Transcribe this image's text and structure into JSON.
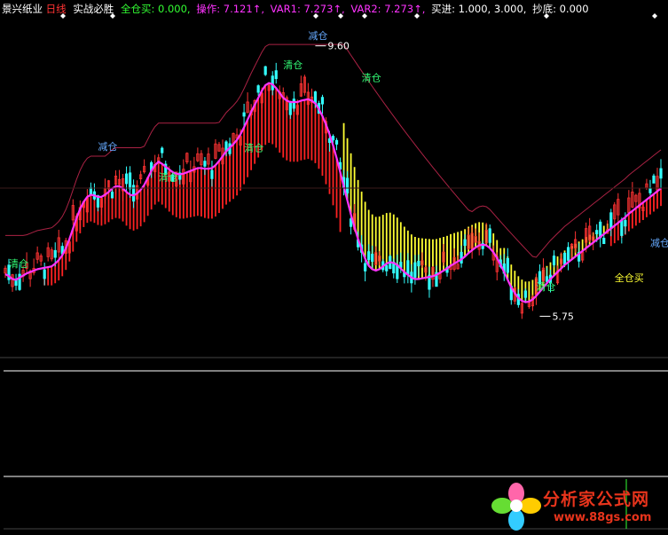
{
  "header": {
    "stock_name": "景兴纸业",
    "period": "日线",
    "indicator_name": "实战必胜",
    "items": [
      {
        "label": "全仓买: 0.000,",
        "color": "#33ff33"
      },
      {
        "label": "操作: 7.121↑,",
        "color": "#ff33ff"
      },
      {
        "label": "VAR1: 7.273↑,",
        "color": "#ff33ff"
      },
      {
        "label": "VAR2: 7.273↑,",
        "color": "#ff33ff"
      },
      {
        "label": "买进: 1.000, 3.000,",
        "color": "#ffffff"
      },
      {
        "label": "抄底: 0.000",
        "color": "#ffffff"
      }
    ]
  },
  "colors": {
    "line": "#ff33ff",
    "rise_candle": "#ff3333",
    "fall_candle": "#33ffff",
    "bull_bar": "#ff2222",
    "bear_bar": "#ffff33",
    "stop_line": "#aa2244",
    "text_reduce": "#66aaff",
    "text_clear": "#33ff77",
    "text_buy": "#ffff33"
  },
  "chart_data": {
    "type": "line",
    "title": "",
    "xlabel": "",
    "ylabel": "",
    "ylim": [
      5.2,
      10.0
    ],
    "x": [
      1,
      2,
      3,
      4,
      5,
      6,
      7,
      8,
      9,
      10,
      11,
      12,
      13,
      14,
      15,
      16,
      17,
      18,
      19,
      20,
      21,
      22,
      23,
      24,
      25,
      26,
      27,
      28,
      29,
      30,
      31,
      32,
      33,
      34,
      35,
      36,
      37,
      38,
      39,
      40,
      41,
      42,
      43,
      44,
      45,
      46,
      47,
      48,
      49,
      50,
      51,
      52,
      53,
      54,
      55,
      56,
      57,
      58,
      59,
      60,
      61,
      62,
      63,
      64,
      65,
      66,
      67,
      68,
      69,
      70,
      71,
      72,
      73,
      74,
      75,
      76,
      77,
      78,
      79,
      80,
      81,
      82,
      83,
      84,
      85,
      86,
      87,
      88,
      89,
      90,
      91,
      92,
      93,
      94,
      95,
      96,
      97,
      98,
      99,
      100,
      101,
      102,
      103,
      104,
      105,
      106,
      107,
      108,
      109,
      110,
      111,
      112,
      113,
      114,
      115,
      116,
      117,
      118,
      119,
      120,
      121,
      122,
      123,
      124,
      125,
      126,
      127,
      128,
      129,
      130,
      131,
      132,
      133,
      134,
      135,
      136,
      137,
      138,
      139,
      140,
      141,
      142,
      143,
      144,
      145,
      146,
      147,
      148,
      149,
      150,
      151,
      152,
      153,
      154,
      155,
      156,
      157,
      158,
      159,
      160,
      161,
      162,
      163,
      164,
      165,
      166,
      167,
      168,
      169,
      170,
      171,
      172,
      173,
      174,
      175,
      176,
      177,
      178,
      179,
      180,
      181,
      182,
      183,
      184,
      185
    ],
    "series": [
      {
        "name": "操作",
        "values": [
          6.35,
          6.32,
          6.28,
          6.27,
          6.3,
          6.33,
          6.36,
          6.38,
          6.4,
          6.42,
          6.43,
          6.44,
          6.45,
          6.46,
          6.5,
          6.55,
          6.62,
          6.72,
          6.85,
          7.0,
          7.15,
          7.28,
          7.38,
          7.45,
          7.48,
          7.47,
          7.45,
          7.45,
          7.48,
          7.52,
          7.57,
          7.6,
          7.6,
          7.57,
          7.52,
          7.48,
          7.47,
          7.5,
          7.55,
          7.62,
          7.72,
          7.82,
          7.9,
          7.95,
          7.92,
          7.88,
          7.84,
          7.8,
          7.78,
          7.77,
          7.78,
          7.8,
          7.82,
          7.84,
          7.86,
          7.86,
          7.85,
          7.85,
          7.86,
          7.9,
          7.96,
          8.03,
          8.1,
          8.15,
          8.2,
          8.26,
          8.34,
          8.44,
          8.55,
          8.66,
          8.76,
          8.86,
          8.96,
          9.04,
          9.07,
          9.05,
          9.0,
          8.93,
          8.86,
          8.82,
          8.8,
          8.8,
          8.8,
          8.82,
          8.83,
          8.84,
          8.82,
          8.78,
          8.7,
          8.6,
          8.48,
          8.34,
          8.18,
          8.0,
          7.8,
          7.6,
          7.4,
          7.2,
          7.02,
          6.85,
          6.7,
          6.57,
          6.47,
          6.42,
          6.4,
          6.42,
          6.46,
          6.5,
          6.52,
          6.51,
          6.48,
          6.43,
          6.38,
          6.34,
          6.3,
          6.28,
          6.28,
          6.29,
          6.3,
          6.31,
          6.32,
          6.34,
          6.37,
          6.4,
          6.43,
          6.47,
          6.5,
          6.53,
          6.56,
          6.6,
          6.65,
          6.69,
          6.73,
          6.76,
          6.77,
          6.76,
          6.72,
          6.66,
          6.58,
          6.48,
          6.38,
          6.27,
          6.16,
          6.08,
          6.01,
          5.97,
          5.95,
          5.96,
          5.99,
          6.04,
          6.1,
          6.16,
          6.22,
          6.28,
          6.33,
          6.38,
          6.43,
          6.48,
          6.52,
          6.56,
          6.6,
          6.64,
          6.68,
          6.72,
          6.76,
          6.8,
          6.84,
          6.88,
          6.92,
          6.96,
          7.0,
          7.04,
          7.08,
          7.12,
          7.16,
          7.21,
          7.25,
          7.29,
          7.33,
          7.37,
          7.41,
          7.45,
          7.49,
          7.53,
          7.57
        ]
      }
    ],
    "annotations": [
      {
        "text": "清仓",
        "kind": "clear",
        "x": 2,
        "y": 6.45
      },
      {
        "text": "减仓",
        "kind": "reduce",
        "x": 27,
        "y": 8.12
      },
      {
        "text": "清仓",
        "kind": "clear",
        "x": 44,
        "y": 7.68
      },
      {
        "text": "清仓",
        "kind": "clear",
        "x": 68,
        "y": 8.1
      },
      {
        "text": "减仓",
        "kind": "reduce",
        "x": 86,
        "y": 9.7
      },
      {
        "text": "清仓",
        "kind": "clear",
        "x": 79,
        "y": 9.28
      },
      {
        "text": "清仓",
        "kind": "clear",
        "x": 101,
        "y": 9.1
      },
      {
        "text": "清仓",
        "kind": "clear",
        "x": 150,
        "y": 6.12
      },
      {
        "text": "全仓买",
        "kind": "buy",
        "x": 172,
        "y": 6.25
      },
      {
        "text": "减仓",
        "kind": "reduce",
        "x": 182,
        "y": 6.75
      }
    ],
    "extremes": [
      {
        "label": "9.60",
        "x": 88,
        "y": 9.6
      },
      {
        "label": "5.75",
        "x": 151,
        "y": 5.75
      }
    ]
  },
  "watermark": {
    "title": "分析家公式网",
    "url": "www.88gs.com"
  }
}
